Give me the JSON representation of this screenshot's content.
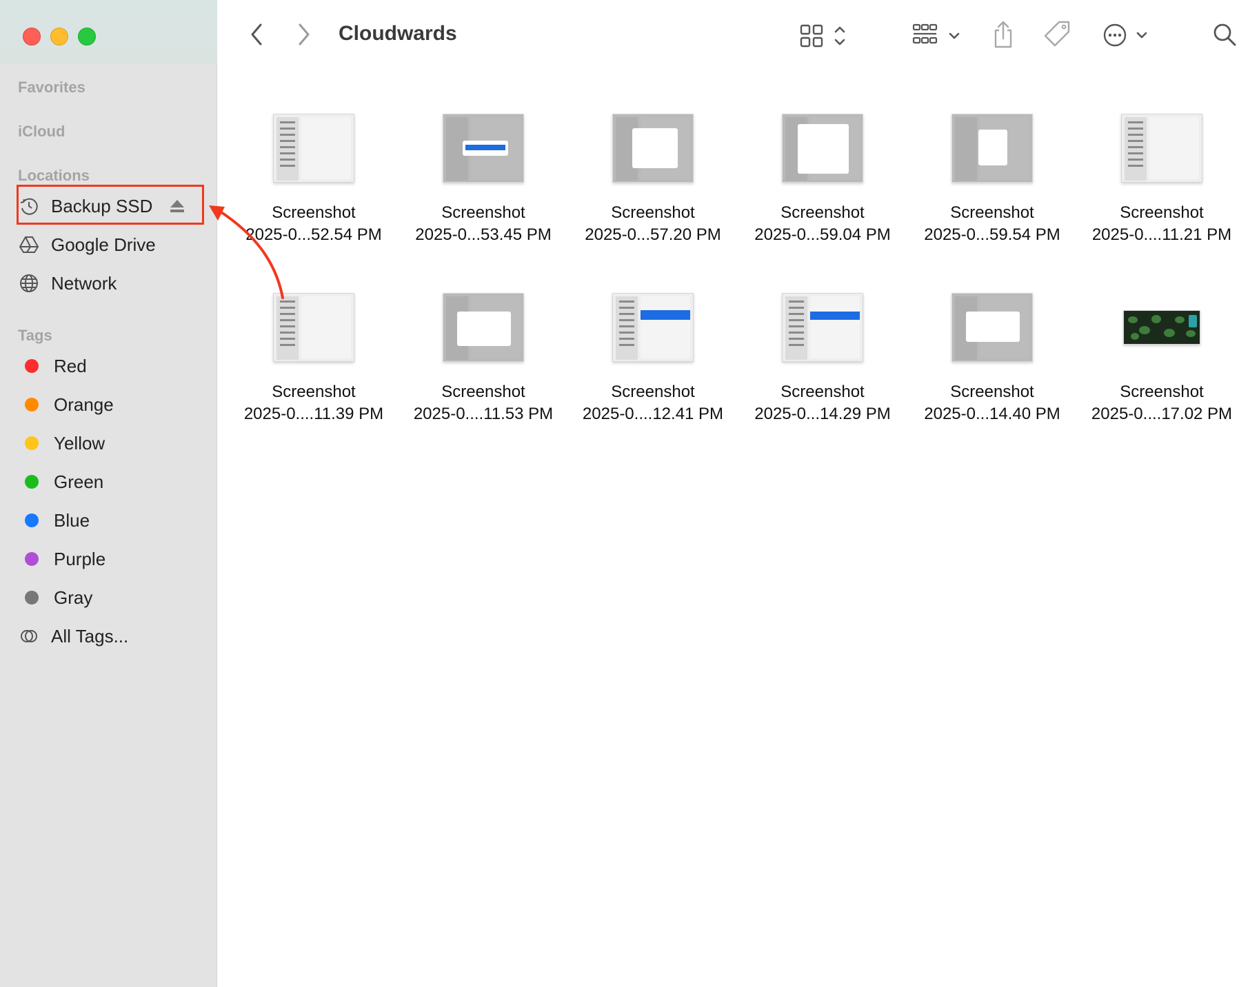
{
  "window": {
    "title": "Cloudwards"
  },
  "sidebar": {
    "favorites_label": "Favorites",
    "icloud_label": "iCloud",
    "locations_label": "Locations",
    "locations": [
      {
        "label": "Backup SSD",
        "icon": "time-machine-icon"
      },
      {
        "label": "Google Drive",
        "icon": "google-drive-icon"
      },
      {
        "label": "Network",
        "icon": "globe-icon"
      }
    ],
    "tags_label": "Tags",
    "tags": [
      {
        "label": "Red",
        "color": "#ff2d2d"
      },
      {
        "label": "Orange",
        "color": "#ff8a00"
      },
      {
        "label": "Yellow",
        "color": "#ffc51a"
      },
      {
        "label": "Green",
        "color": "#1bbd1b"
      },
      {
        "label": "Blue",
        "color": "#1679ff"
      },
      {
        "label": "Purple",
        "color": "#b04fd6"
      },
      {
        "label": "Gray",
        "color": "#777777"
      }
    ],
    "all_tags_label": "All Tags..."
  },
  "files": [
    {
      "name_line1": "Screenshot",
      "name_line2": "2025-0...52.54 PM"
    },
    {
      "name_line1": "Screenshot",
      "name_line2": "2025-0...53.45 PM"
    },
    {
      "name_line1": "Screenshot",
      "name_line2": "2025-0...57.20 PM"
    },
    {
      "name_line1": "Screenshot",
      "name_line2": "2025-0...59.04 PM"
    },
    {
      "name_line1": "Screenshot",
      "name_line2": "2025-0...59.54 PM"
    },
    {
      "name_line1": "Screenshot",
      "name_line2": "2025-0....11.21 PM"
    },
    {
      "name_line1": "Screenshot",
      "name_line2": "2025-0....11.39 PM"
    },
    {
      "name_line1": "Screenshot",
      "name_line2": "2025-0....11.53 PM"
    },
    {
      "name_line1": "Screenshot",
      "name_line2": "2025-0....12.41 PM"
    },
    {
      "name_line1": "Screenshot",
      "name_line2": "2025-0...14.29 PM"
    },
    {
      "name_line1": "Screenshot",
      "name_line2": "2025-0...14.40 PM"
    },
    {
      "name_line1": "Screenshot",
      "name_line2": "2025-0....17.02 PM"
    }
  ],
  "annotation": {
    "highlight_color": "#f0391f"
  }
}
